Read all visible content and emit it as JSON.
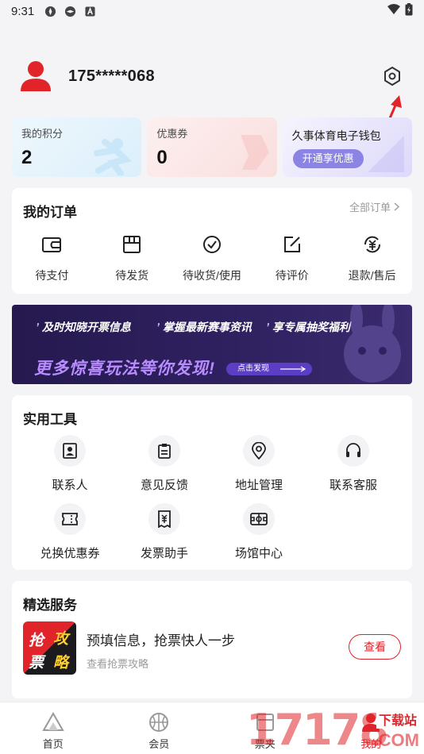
{
  "status_bar": {
    "time": "9:31"
  },
  "profile": {
    "phone": "175*****068"
  },
  "cards": {
    "points": {
      "label": "我的积分",
      "value": "2"
    },
    "coupons": {
      "label": "优惠券",
      "value": "0"
    },
    "wallet": {
      "label": "久事体育电子钱包",
      "button": "开通享优惠"
    }
  },
  "orders": {
    "title": "我的订单",
    "all_link": "全部订单",
    "items": [
      {
        "label": "待支付",
        "icon": "wallet-icon"
      },
      {
        "label": "待发货",
        "icon": "package-icon"
      },
      {
        "label": "待收货/使用",
        "icon": "check-circle-icon"
      },
      {
        "label": "待评价",
        "icon": "edit-icon"
      },
      {
        "label": "退款/售后",
        "icon": "refund-icon"
      }
    ]
  },
  "banner": {
    "taglines": [
      "及时知晓开票信息",
      "掌握最新赛事资讯",
      "享专属抽奖福利"
    ],
    "headline": "更多惊喜玩法等你发现!",
    "cta": "点击发现"
  },
  "tools": {
    "title": "实用工具",
    "items": [
      {
        "label": "联系人",
        "icon": "contact-icon"
      },
      {
        "label": "意见反馈",
        "icon": "feedback-icon"
      },
      {
        "label": "地址管理",
        "icon": "location-icon"
      },
      {
        "label": "联系客服",
        "icon": "headset-icon"
      },
      {
        "label": "兑换优惠券",
        "icon": "ticket-icon"
      },
      {
        "label": "发票助手",
        "icon": "invoice-icon"
      },
      {
        "label": "场馆中心",
        "icon": "venue-icon"
      }
    ]
  },
  "services": {
    "title": "精选服务",
    "thumb_text": [
      "抢",
      "攻",
      "票",
      "略"
    ],
    "item_title": "预填信息，抢票快人一步",
    "item_subtitle": "查看抢票攻略",
    "button": "查看"
  },
  "tabbar": {
    "items": [
      {
        "label": "首页",
        "icon": "home-icon"
      },
      {
        "label": "会员",
        "icon": "basketball-icon"
      },
      {
        "label": "票夹",
        "icon": "ticket-folder-icon"
      },
      {
        "label": "我的",
        "icon": "user-icon"
      }
    ]
  },
  "watermark": {
    "number": "17178",
    "tag": "下载站",
    "suffix": ".COM"
  },
  "colors": {
    "accent_red": "#e0242a",
    "wallet_purple": "#8c84e4",
    "banner_bg": "#2a1d58"
  }
}
